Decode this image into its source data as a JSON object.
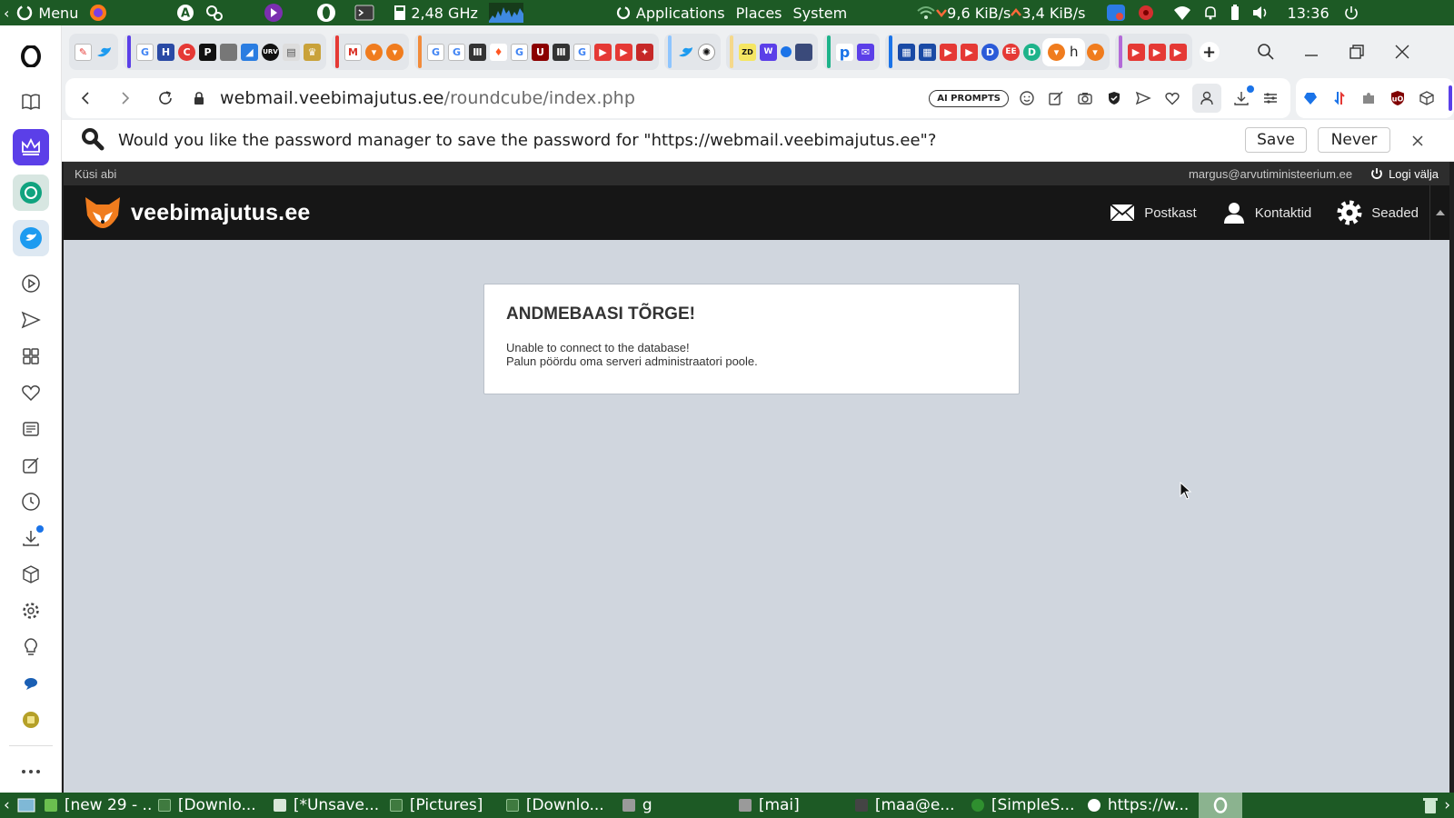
{
  "system_panel": {
    "menu_label": "Menu",
    "cpu_freq": "2,48 GHz",
    "applications": "Applications",
    "places": "Places",
    "system": "System",
    "net_down": "9,6 KiB/s",
    "net_up": "3,4 KiB/s",
    "clock": "13:36"
  },
  "browser": {
    "url_host": "webmail.veebimajutus.ee",
    "url_path": "/roundcube/index.php",
    "ai_prompts_label": "AI PROMPTS",
    "password_prompt": "Would you like the password manager to save the password for \"https://webmail.veebimajutus.ee\"?",
    "save_label": "Save",
    "never_label": "Never",
    "active_tab_letter": "h"
  },
  "webmail": {
    "help_link": "Küsi abi",
    "user_email": "margus@arvutiministeerium.ee",
    "logout_label": "Logi välja",
    "logo_text": "veebimajutus.ee",
    "nav": {
      "mail": "Postkast",
      "contacts": "Kontaktid",
      "settings": "Seaded"
    },
    "error": {
      "title": "ANDMEBAASI TÕRGE!",
      "line1": "Unable to connect to the database!",
      "line2": "Palun pöördu oma serveri administraatori poole."
    }
  },
  "taskbar": {
    "tasks": [
      "[new 29 - ...",
      "[Downlo...",
      "[*Unsave...",
      "[Pictures]",
      "[Downlo...",
      "g",
      "[mai]",
      "[maa@e...",
      "[SimpleS...",
      "https://w..."
    ]
  },
  "colors": {
    "panel_green": "#1d5a25",
    "page_bg": "#d0d6de",
    "header_bg": "#161616",
    "logo_orange": "#f07c1e"
  }
}
